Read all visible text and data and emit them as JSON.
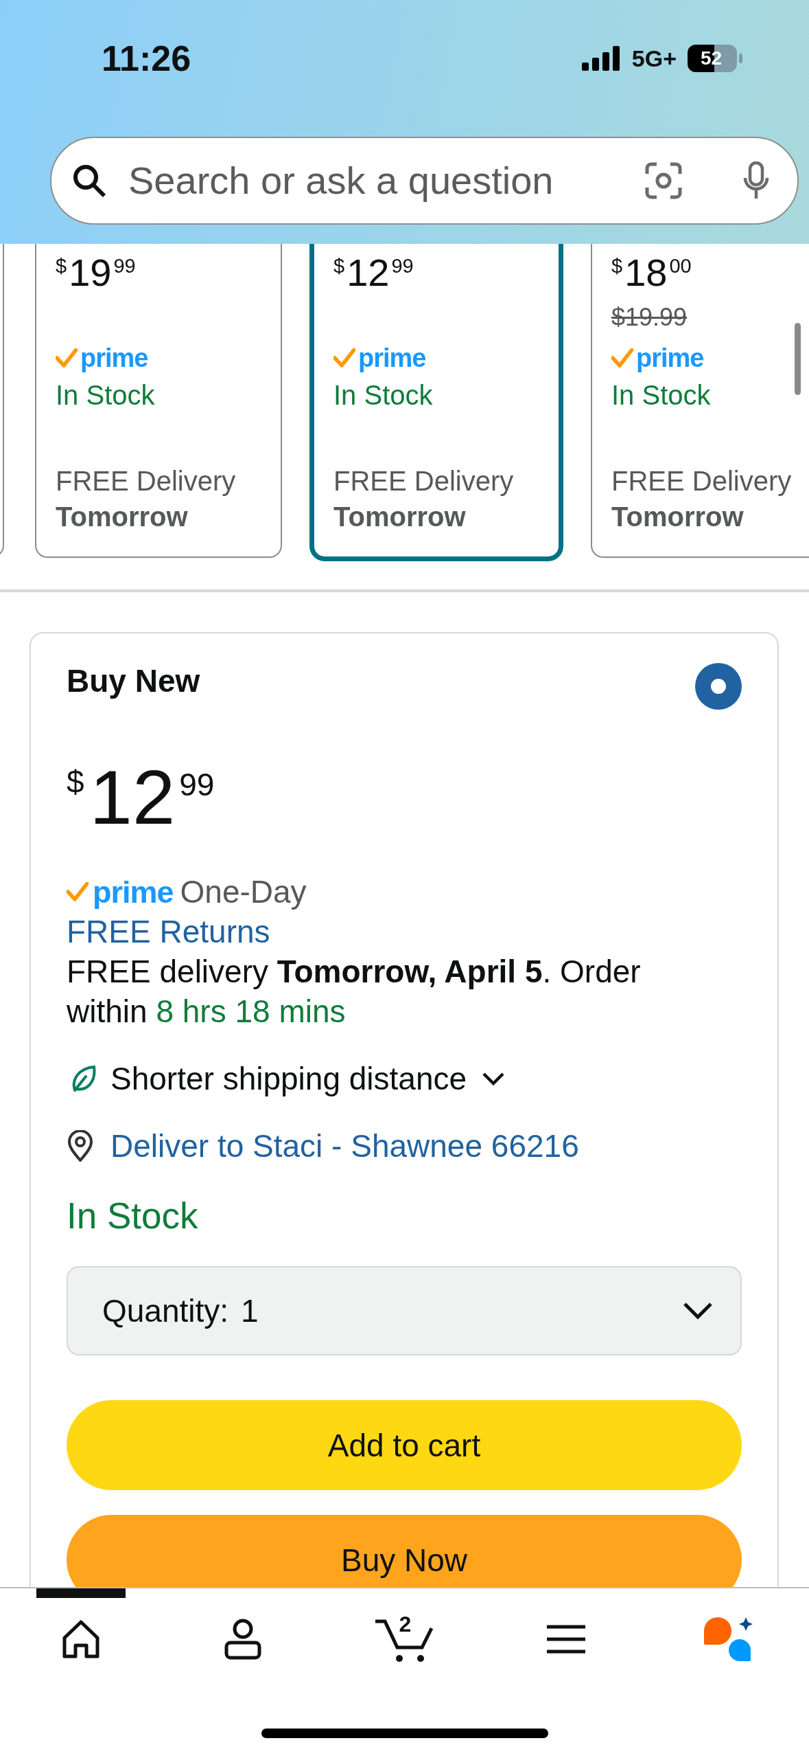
{
  "status_bar": {
    "time": "11:26",
    "network": "5G+",
    "battery": "52"
  },
  "search": {
    "placeholder": "Search or ask a question"
  },
  "offers": [
    {
      "selected": false
    },
    {
      "price": {
        "symbol": "$",
        "whole": "19",
        "fraction": "99"
      },
      "prime_badge": "prime",
      "stock": "In Stock",
      "delivery": "FREE Delivery",
      "delivery_day": "Tomorrow",
      "selected": false
    },
    {
      "price": {
        "symbol": "$",
        "whole": "12",
        "fraction": "99"
      },
      "prime_badge": "prime",
      "stock": "In Stock",
      "delivery": "FREE Delivery",
      "delivery_day": "Tomorrow",
      "selected": true
    },
    {
      "price": {
        "symbol": "$",
        "whole": "18",
        "fraction": "00"
      },
      "list_price": "$19.99",
      "prime_badge": "prime",
      "stock": "In Stock",
      "delivery": "FREE Delivery",
      "delivery_day": "Tomorrow",
      "selected": false
    }
  ],
  "buy_box": {
    "title": "Buy New",
    "selected": true,
    "price": {
      "symbol": "$",
      "whole": "12",
      "fraction": "99"
    },
    "prime_badge": "prime",
    "prime_speed": "One-Day",
    "returns_link": "FREE Returns",
    "delivery_text": "FREE delivery **Tomorrow, April 5**. Order within",
    "delivery_countdown": "8 hrs 18 mins",
    "shipping_note": {
      "label": "Shorter shipping distance",
      "expanded": false
    },
    "deliver_to": "Deliver to Staci - Shawnee 66216",
    "stock": "In Stock",
    "quantity": {
      "label": "Quantity:",
      "value": "1"
    },
    "buttons": [
      {
        "kind": "add_to_cart",
        "label": "Add to cart"
      },
      {
        "kind": "buy_now",
        "label": "Buy Now"
      }
    ]
  },
  "nav": [
    {
      "kind": "home",
      "selected": true
    },
    {
      "kind": "account",
      "selected": false
    },
    {
      "kind": "cart",
      "badge": "2",
      "selected": false
    },
    {
      "kind": "menu",
      "selected": false
    },
    {
      "kind": "assistant",
      "selected": false
    }
  ]
}
